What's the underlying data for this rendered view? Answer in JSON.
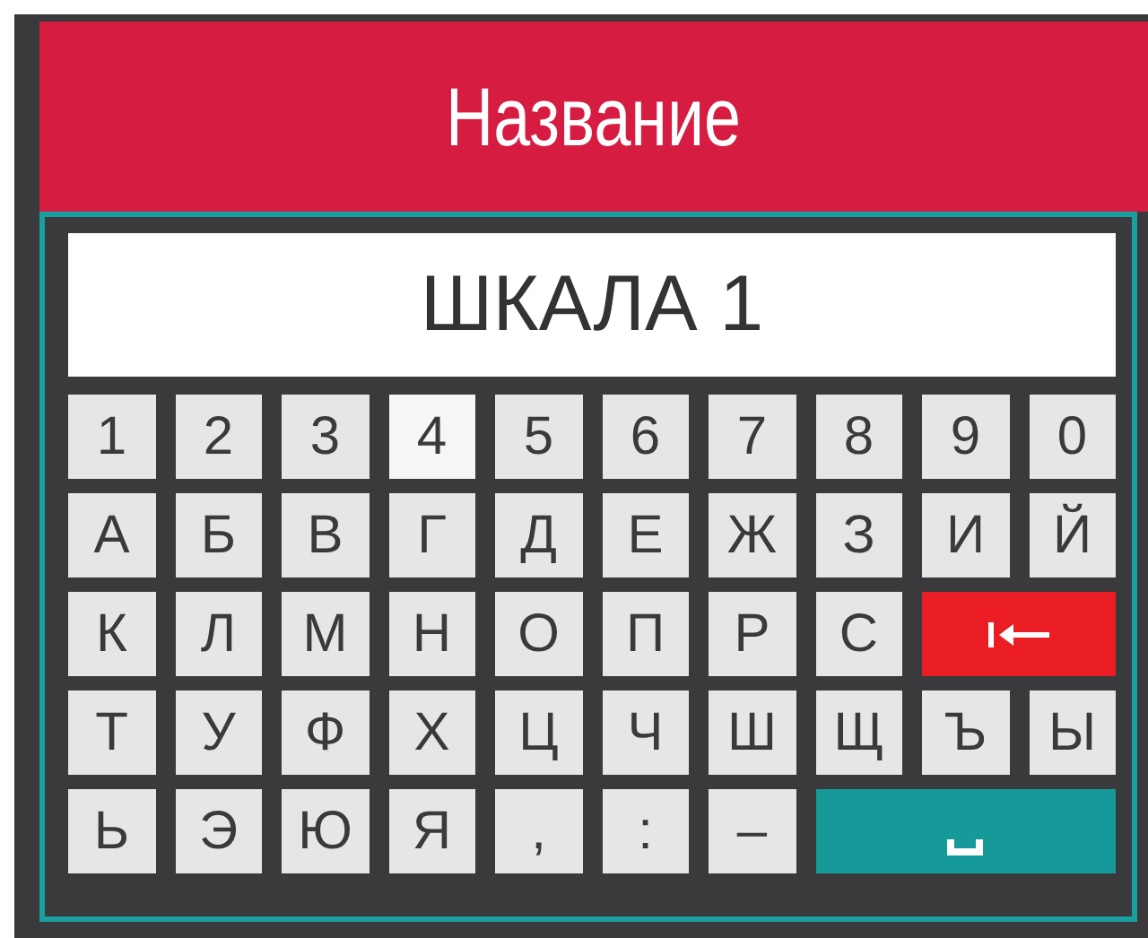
{
  "header": {
    "title": "Название"
  },
  "input": {
    "value": "ШКАЛА 1"
  },
  "keys": [
    {
      "kind": "char",
      "label": "1",
      "selected": false
    },
    {
      "kind": "char",
      "label": "2",
      "selected": false
    },
    {
      "kind": "char",
      "label": "3",
      "selected": false
    },
    {
      "kind": "char",
      "label": "4",
      "selected": true
    },
    {
      "kind": "char",
      "label": "5",
      "selected": false
    },
    {
      "kind": "char",
      "label": "6",
      "selected": false
    },
    {
      "kind": "char",
      "label": "7",
      "selected": false
    },
    {
      "kind": "char",
      "label": "8",
      "selected": false
    },
    {
      "kind": "char",
      "label": "9",
      "selected": false
    },
    {
      "kind": "char",
      "label": "0",
      "selected": false
    },
    {
      "kind": "char",
      "label": "А",
      "selected": false
    },
    {
      "kind": "char",
      "label": "Б",
      "selected": false
    },
    {
      "kind": "char",
      "label": "В",
      "selected": false
    },
    {
      "kind": "char",
      "label": "Г",
      "selected": false
    },
    {
      "kind": "char",
      "label": "Д",
      "selected": false
    },
    {
      "kind": "char",
      "label": "Е",
      "selected": false
    },
    {
      "kind": "char",
      "label": "Ж",
      "selected": false
    },
    {
      "kind": "char",
      "label": "З",
      "selected": false
    },
    {
      "kind": "char",
      "label": "И",
      "selected": false
    },
    {
      "kind": "char",
      "label": "Й",
      "selected": false
    },
    {
      "kind": "char",
      "label": "К",
      "selected": false
    },
    {
      "kind": "char",
      "label": "Л",
      "selected": false
    },
    {
      "kind": "char",
      "label": "М",
      "selected": false
    },
    {
      "kind": "char",
      "label": "Н",
      "selected": false
    },
    {
      "kind": "char",
      "label": "О",
      "selected": false
    },
    {
      "kind": "char",
      "label": "П",
      "selected": false
    },
    {
      "kind": "char",
      "label": "Р",
      "selected": false
    },
    {
      "kind": "char",
      "label": "С",
      "selected": false
    },
    {
      "kind": "backspace",
      "selected": false
    },
    {
      "kind": "char",
      "label": "Т",
      "selected": false
    },
    {
      "kind": "char",
      "label": "У",
      "selected": false
    },
    {
      "kind": "char",
      "label": "Ф",
      "selected": false
    },
    {
      "kind": "char",
      "label": "Х",
      "selected": false
    },
    {
      "kind": "char",
      "label": "Ц",
      "selected": false
    },
    {
      "kind": "char",
      "label": "Ч",
      "selected": false
    },
    {
      "kind": "char",
      "label": "Ш",
      "selected": false
    },
    {
      "kind": "char",
      "label": "Щ",
      "selected": false
    },
    {
      "kind": "char",
      "label": "Ъ",
      "selected": false
    },
    {
      "kind": "char",
      "label": "Ы",
      "selected": false
    },
    {
      "kind": "char",
      "label": "Ь",
      "selected": false
    },
    {
      "kind": "char",
      "label": "Э",
      "selected": false
    },
    {
      "kind": "char",
      "label": "Ю",
      "selected": false
    },
    {
      "kind": "char",
      "label": "Я",
      "selected": false
    },
    {
      "kind": "char",
      "label": ",",
      "selected": false
    },
    {
      "kind": "char",
      "label": ":",
      "selected": false
    },
    {
      "kind": "char",
      "label": "–",
      "selected": false
    },
    {
      "kind": "space",
      "selected": false
    }
  ]
}
